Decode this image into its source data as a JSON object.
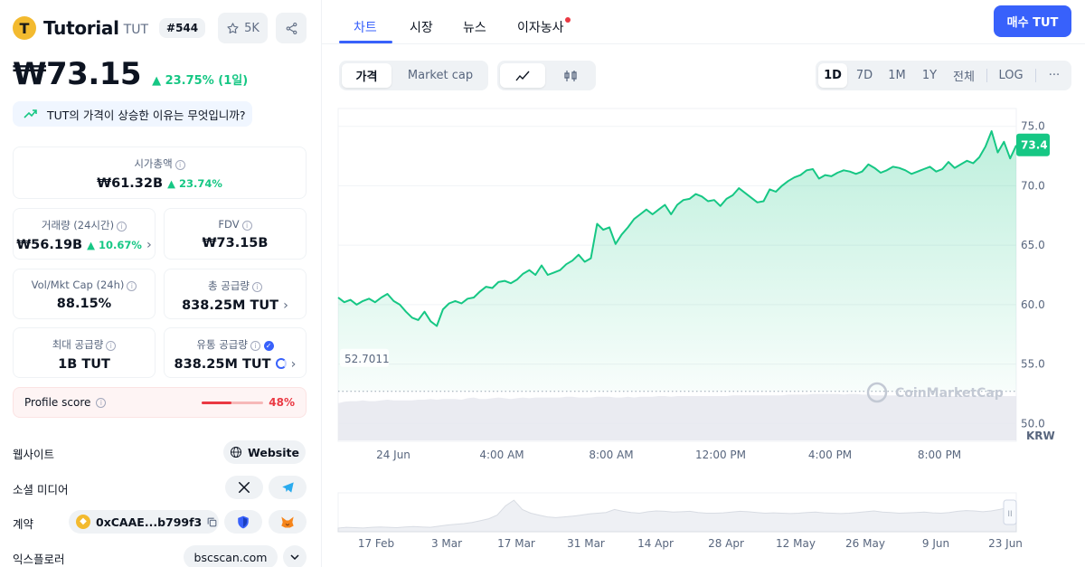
{
  "coin": {
    "logo_letter": "T",
    "name": "Tutorial",
    "symbol": "TUT",
    "rank": "#544",
    "watchlist_count": "5K",
    "price": "₩73.15",
    "change": "23.75% (1일)",
    "reason_question": "TUT의 가격이 상승한 이유는 무엇입니까?"
  },
  "stats": {
    "market_cap": {
      "label": "시가총액",
      "value": "₩61.32B",
      "change": "23.74%"
    },
    "volume": {
      "label": "거래량 (24시간)",
      "value": "₩56.19B",
      "change": "10.67%"
    },
    "fdv": {
      "label": "FDV",
      "value": "₩73.15B"
    },
    "vol_mkt_cap": {
      "label": "Vol/Mkt Cap (24h)",
      "value": "88.15%"
    },
    "total_supply": {
      "label": "총 공급량",
      "value": "838.25M TUT"
    },
    "max_supply": {
      "label": "최대 공급량",
      "value": "1B TUT"
    },
    "circulating_supply": {
      "label": "유통 공급량",
      "value": "838.25M TUT"
    }
  },
  "profile": {
    "label": "Profile score",
    "value": "48%",
    "score_fraction": 0.48
  },
  "links": {
    "website_label": "웹사이트",
    "website_button": "Website",
    "social_label": "소셜 미디어",
    "contract_label": "계약",
    "contract_address": "0xCAAE...b799f3",
    "explorer_label": "익스플로러",
    "explorer_value": "bscscan.com"
  },
  "nav": {
    "tabs": [
      "차트",
      "시장",
      "뉴스",
      "이자농사"
    ],
    "buy_button": "매수 TUT"
  },
  "chart_controls": {
    "price_tab": "가격",
    "mcap_tab": "Market cap",
    "ranges": [
      "1D",
      "7D",
      "1M",
      "1Y",
      "전체",
      "LOG"
    ],
    "more": "···",
    "active_range": "1D"
  },
  "chart_data": {
    "type": "area",
    "currency": "KRW",
    "y_ticks": [
      "75.0",
      "70.0",
      "65.0",
      "60.0",
      "55.0",
      "50.0"
    ],
    "ylim": [
      48.5,
      76.5
    ],
    "x_ticks": [
      "24 Jun",
      "4:00 AM",
      "8:00 AM",
      "12:00 PM",
      "4:00 PM",
      "8:00 PM"
    ],
    "open_price_label": "52.7011",
    "open_price_value": 52.7011,
    "current_price_label": "73.4",
    "current_price_value": 73.4,
    "watermark": "CoinMarketCap",
    "price_series": [
      60.6,
      60.2,
      60.4,
      60.0,
      60.3,
      60.5,
      60.2,
      60.6,
      60.9,
      60.3,
      60.0,
      59.4,
      58.9,
      58.7,
      59.4,
      58.6,
      58.2,
      59.6,
      60.1,
      60.3,
      60.1,
      60.5,
      60.6,
      61.1,
      61.5,
      61.4,
      61.9,
      62.0,
      61.8,
      62.1,
      62.6,
      62.9,
      62.5,
      63.3,
      62.5,
      62.7,
      62.9,
      63.4,
      63.7,
      64.2,
      63.6,
      63.9,
      66.8,
      66.3,
      66.5,
      65.1,
      65.9,
      66.5,
      67.2,
      67.6,
      68.0,
      67.6,
      68.0,
      68.4,
      67.6,
      68.4,
      68.8,
      68.9,
      69.3,
      69.1,
      68.7,
      68.8,
      68.3,
      68.9,
      69.2,
      69.8,
      69.4,
      69.0,
      68.6,
      68.7,
      69.7,
      69.5,
      70.0,
      70.4,
      70.7,
      70.9,
      71.3,
      71.4,
      70.6,
      70.9,
      70.8,
      71.1,
      71.3,
      71.2,
      71.0,
      71.2,
      71.8,
      71.5,
      71.1,
      71.3,
      71.6,
      71.5,
      71.3,
      71.0,
      71.2,
      71.4,
      71.6,
      71.2,
      71.4,
      72.0,
      71.5,
      71.8,
      72.1,
      71.9,
      72.4,
      73.3,
      74.6,
      72.8,
      73.7,
      72.3,
      73.4
    ],
    "volume_series": [
      52,
      54,
      55,
      55,
      56,
      55,
      55,
      56,
      57,
      56,
      56,
      56,
      56,
      57,
      57,
      58,
      57,
      58,
      58,
      58,
      57,
      59,
      60,
      58,
      58,
      59,
      60,
      59,
      58,
      59,
      60,
      59,
      60,
      60,
      60,
      60,
      60,
      61,
      61,
      60,
      60,
      60,
      61,
      61,
      61,
      60,
      60,
      61,
      60,
      61,
      61,
      61,
      62,
      62,
      61,
      62,
      62,
      62,
      62,
      62,
      62,
      62,
      62,
      62,
      63,
      63,
      63,
      63,
      63,
      63,
      63,
      63,
      63,
      64,
      64,
      64,
      64,
      65,
      65,
      65,
      65,
      65,
      64,
      65,
      65,
      64,
      64,
      63,
      63,
      63,
      63,
      63,
      62,
      62,
      62,
      62,
      62,
      62,
      62,
      62,
      62,
      62,
      62,
      62,
      62,
      62,
      62,
      62,
      62,
      62,
      62
    ],
    "navigator": {
      "x_ticks": [
        "17 Feb",
        "3 Mar",
        "17 Mar",
        "31 Mar",
        "14 Apr",
        "28 Apr",
        "12 May",
        "26 May",
        "9 Jun",
        "23 Jun"
      ],
      "series": [
        0.1,
        0.12,
        0.11,
        0.1,
        0.12,
        0.13,
        0.12,
        0.11,
        0.13,
        0.14,
        0.13,
        0.12,
        0.15,
        0.18,
        0.2,
        0.22,
        0.25,
        0.3,
        0.35,
        0.45,
        0.7,
        0.85,
        0.6,
        0.5,
        0.45,
        0.4,
        0.38,
        0.4,
        0.42,
        0.45,
        0.48,
        0.5,
        0.52,
        0.6,
        0.55,
        0.52,
        0.5,
        0.54,
        0.56,
        0.55,
        0.53,
        0.54,
        0.55,
        0.52,
        0.5,
        0.5,
        0.51,
        0.53,
        0.55,
        0.54,
        0.52,
        0.5,
        0.51,
        0.5,
        0.49,
        0.5,
        0.52,
        0.53,
        0.51,
        0.5,
        0.49,
        0.5,
        0.52,
        0.54,
        0.56,
        0.53,
        0.52,
        0.5,
        0.51,
        0.52,
        0.53,
        0.51,
        0.5,
        0.52,
        0.55,
        0.57,
        0.56,
        0.54,
        0.56,
        0.6,
        0.65,
        0.62
      ]
    }
  },
  "colors": {
    "accent": "#3861fb",
    "up": "#16c784",
    "down": "#ea3943"
  }
}
